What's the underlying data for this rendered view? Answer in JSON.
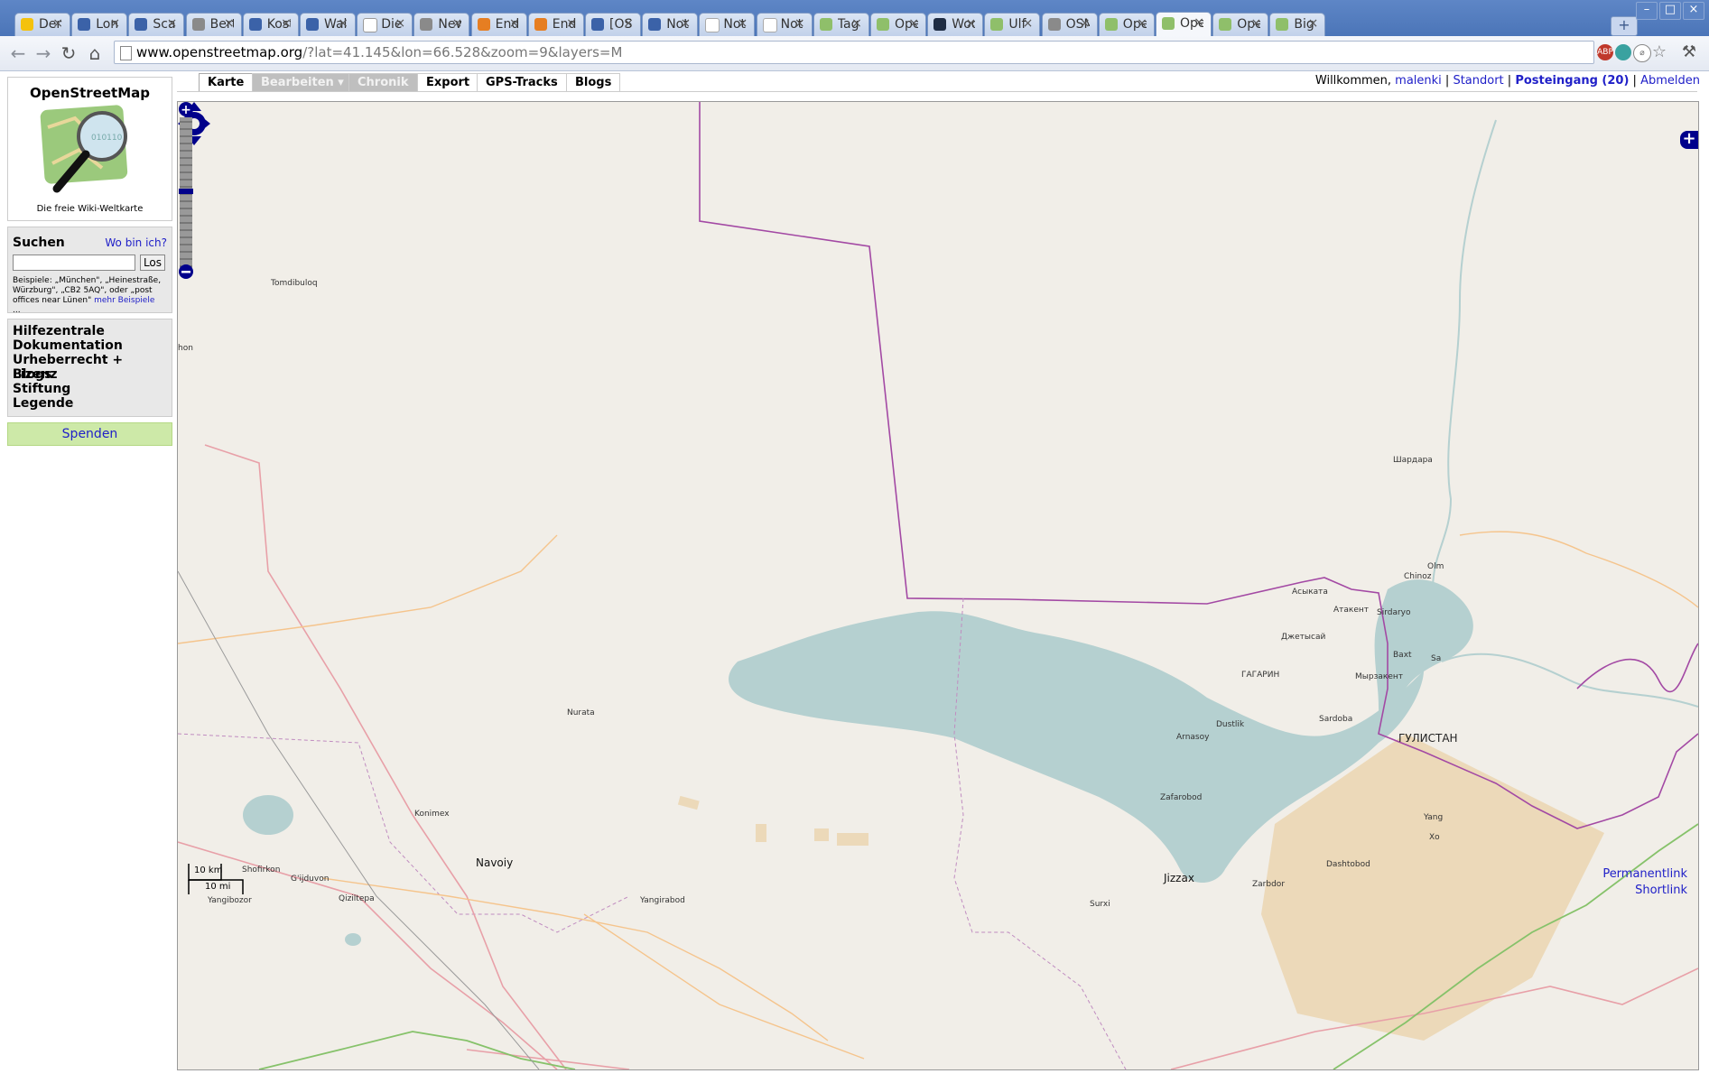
{
  "browser": {
    "tabs": [
      {
        "label": "Der",
        "icon": "nbc-icon",
        "fav": "f-nbc"
      },
      {
        "label": "Lon",
        "icon": "globe-icon",
        "fav": "f-blue"
      },
      {
        "label": "Sca",
        "icon": "globe-icon",
        "fav": "f-blue"
      },
      {
        "label": "Bert",
        "icon": "building-icon",
        "fav": "f-gray"
      },
      {
        "label": "Kost",
        "icon": "bank-icon",
        "fav": "f-blue"
      },
      {
        "label": "Wal",
        "icon": "globe-icon",
        "fav": "f-blue"
      },
      {
        "label": "Die",
        "icon": "amazon-icon",
        "fav": "f-amazon"
      },
      {
        "label": "New",
        "icon": "gear-icon",
        "fav": "f-gray"
      },
      {
        "label": "End",
        "icon": "blogger-icon",
        "fav": "f-orange"
      },
      {
        "label": "End",
        "icon": "blogger-icon",
        "fav": "f-orange"
      },
      {
        "label": "[OS",
        "icon": "globe-icon",
        "fav": "f-blue"
      },
      {
        "label": "Not",
        "icon": "cp-icon",
        "fav": "f-blue"
      },
      {
        "label": "Not",
        "icon": "at-icon",
        "fav": "f-at"
      },
      {
        "label": "Not",
        "icon": "at-icon",
        "fav": "f-at"
      },
      {
        "label": "Tag",
        "icon": "osm-icon",
        "fav": "f-osm"
      },
      {
        "label": "Ope",
        "icon": "osm-icon",
        "fav": "f-osm"
      },
      {
        "label": "Woo",
        "icon": "dark-icon",
        "fav": "f-dark"
      },
      {
        "label": "Ulf",
        "icon": "osm-icon",
        "fav": "f-osm"
      },
      {
        "label": "OSM",
        "icon": "search-icon",
        "fav": "f-gray"
      },
      {
        "label": "Ope",
        "icon": "osm-icon",
        "fav": "f-osm"
      },
      {
        "label": "Ope",
        "icon": "osm-icon",
        "fav": "f-osm",
        "active": true
      },
      {
        "label": "Ope",
        "icon": "osm-icon",
        "fav": "f-osm"
      },
      {
        "label": "Big",
        "icon": "osm-icon",
        "fav": "f-osm"
      }
    ],
    "url_host": "www.openstreetmap.org",
    "url_rest": "/?lat=41.145&lon=66.528&zoom=9&layers=M"
  },
  "sidebar": {
    "site_title": "OpenStreetMap",
    "tagline": "Die freie Wiki-Weltkarte",
    "search": {
      "title": "Suchen",
      "where_link": "Wo bin ich?",
      "input_value": "",
      "go_label": "Los",
      "examples": "Beispiele: „München\", „Heinestraße, Würzburg\", „CB2 5AQ\", oder „post offices near Lünen\"",
      "more_link": "mehr Beispiele",
      "ellipsis": "..."
    },
    "nav": [
      "Hilfezentrale",
      "Dokumentation",
      "Urheberrecht + Lizenz",
      "Blogs",
      "Stiftung",
      "Legende"
    ],
    "donate": "Spenden"
  },
  "tabs": {
    "karte": "Karte",
    "bearbeiten": "Bearbeiten ▾",
    "chronik": "Chronik",
    "export": "Export",
    "gps": "GPS-Tracks",
    "blogs": "Blogs"
  },
  "user": {
    "welcome": "Willkommen,",
    "username": "malenki",
    "sep": "|",
    "location": "Standort",
    "inbox": "Posteingang (20)",
    "logout": "Abmelden"
  },
  "map": {
    "labels": {
      "tomdibuloq": "Tomdibuloq",
      "shardara": "Шардара",
      "nurata": "Nurata",
      "konimex": "Konimex",
      "navoiy": "Navoiy",
      "shofirkon": "Shofirkon",
      "gijduvon": "G'ijduvon",
      "qiziltepa": "Qiziltepa",
      "yangibozor": "Yangibozor",
      "yangirabod": "Yangirabod",
      "jizzax": "Jizzax",
      "zarbdor": "Zarbdor",
      "dashtobod": "Dashtobod",
      "zafarobod": "Zafarobod",
      "arnasoy": "Arnasoy",
      "dustlik": "Dustlik",
      "gagarin": "ГАГАРИН",
      "sardoba": "Sardoba",
      "gulistan": "ГУЛИСТАН",
      "asykata": "Асыката",
      "atakent": "Атакент",
      "jetysay": "Джетысай",
      "myrzakent": "Мырзакент",
      "sirdaryo": "Sirdaryo",
      "chinoz": "Chinoz",
      "baxt": "Baxt",
      "hon": "hon",
      "olm": "Olm",
      "sa": "Sa",
      "yang": "Yang",
      "xo": "Xo",
      "sur": "Surxi"
    },
    "scale_km": "10 km",
    "scale_mi": "10 mi",
    "permalink": "Permanentlink",
    "shortlink": "Shortlink"
  },
  "colors": {
    "land": "#f1eee8",
    "water": "#b5d0d0",
    "border": "#a349a4",
    "road_primary": "#e8a0a8",
    "road_secondary": "#f5c48c",
    "road_trunk": "#86c26a",
    "farmland": "#ecd9b9",
    "link": "#2020c8"
  }
}
